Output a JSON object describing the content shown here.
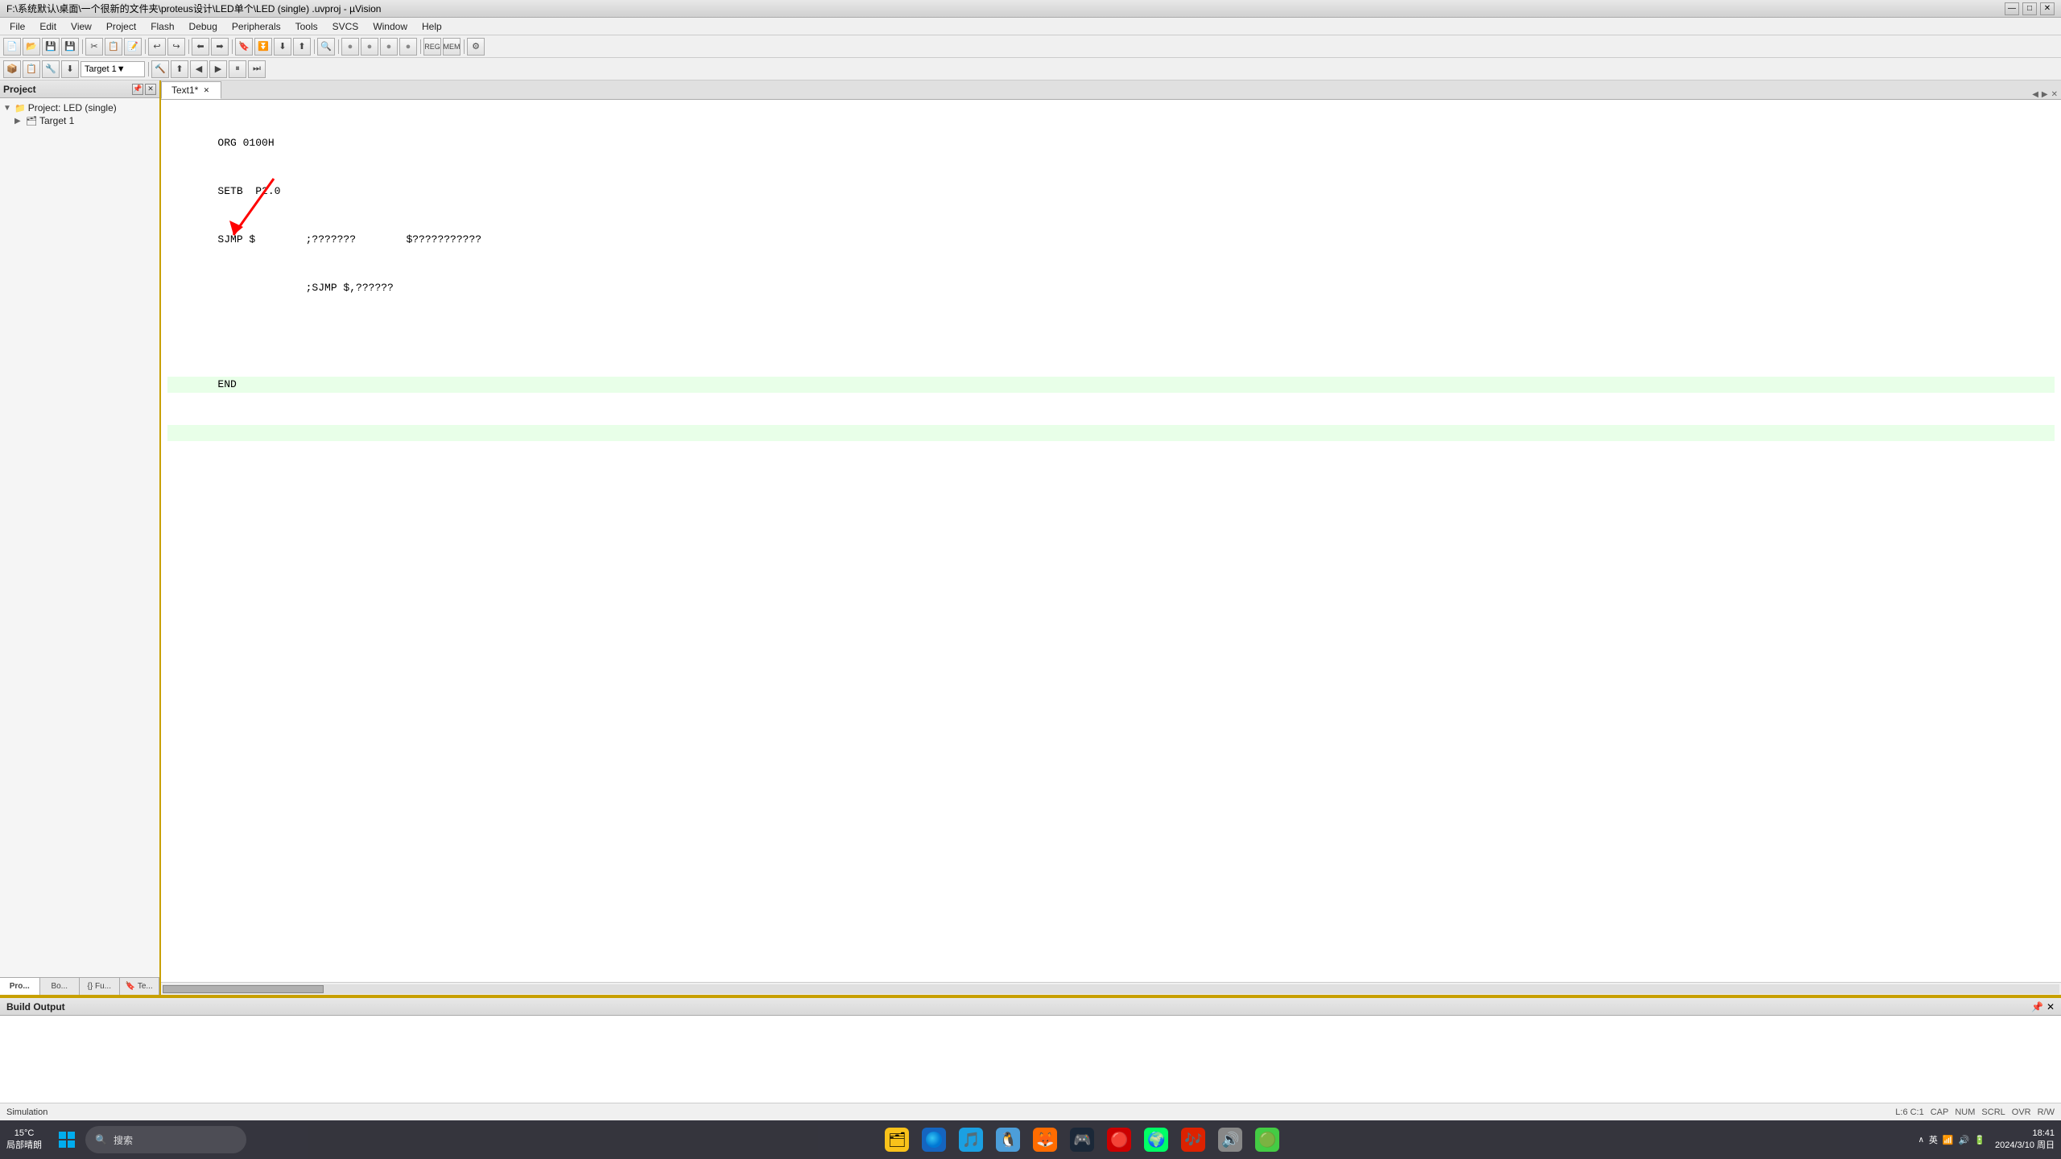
{
  "titleBar": {
    "title": "F:\\系统默认\\桌面\\一个很新的文件夹\\proteus设计\\LED单个\\LED (single) .uvproj - µVision",
    "controls": [
      "—",
      "□",
      "✕"
    ]
  },
  "menuBar": {
    "items": [
      "File",
      "Edit",
      "View",
      "Project",
      "Flash",
      "Debug",
      "Peripherals",
      "Tools",
      "SVCS",
      "Window",
      "Help"
    ]
  },
  "toolbar1": {
    "buttons": [
      "📄",
      "📂",
      "💾",
      "✂",
      "📋",
      "📝",
      "↩",
      "↪",
      "⬅",
      "➡",
      "⏹",
      "▶",
      "🔍"
    ]
  },
  "toolbar2": {
    "targetDropdown": "Target 1",
    "buttons": [
      "📦",
      "📋",
      "🔧",
      "◀",
      "▶",
      "⏸"
    ]
  },
  "projectPanel": {
    "title": "Project",
    "treeItems": [
      {
        "label": "Project: LED (single)",
        "level": 0,
        "icon": "📁",
        "expanded": true
      },
      {
        "label": "Target 1",
        "level": 1,
        "icon": "🗂",
        "expanded": false
      }
    ],
    "tabs": [
      {
        "label": "Pro...",
        "active": true
      },
      {
        "label": "Bo...",
        "active": false
      },
      {
        "label": "{} Fu...",
        "active": false
      },
      {
        "label": "🔖 Te...",
        "active": false
      }
    ]
  },
  "editor": {
    "tabs": [
      {
        "label": "Text1*",
        "active": true
      }
    ],
    "code": [
      {
        "line": "        ORG 0100H",
        "highlighted": false
      },
      {
        "line": "        SETB  P2.0",
        "highlighted": false
      },
      {
        "line": "        SJMP $        ;???????        $???????????",
        "highlighted": false
      },
      {
        "line": "                      ;SJMP $,??????",
        "highlighted": false
      },
      {
        "line": "",
        "highlighted": false
      },
      {
        "line": "        END",
        "highlighted": true
      },
      {
        "line": "",
        "highlighted": true
      }
    ]
  },
  "buildOutput": {
    "title": "Build Output",
    "content": ""
  },
  "statusBar": {
    "left": "Simulation",
    "position": "L:6 C:1",
    "caps": "CAP",
    "num": "NUM",
    "scrl": "SCRL",
    "ovr": "OVR",
    "rw": "R/W"
  },
  "taskbar": {
    "weather": {
      "temp": "15°C",
      "location": "局部晴朗"
    },
    "searchPlaceholder": "搜索",
    "apps": [
      {
        "name": "windows-start",
        "emoji": "⊞",
        "color": "#0078d4"
      },
      {
        "name": "file-explorer",
        "emoji": "🗂",
        "color": "#f9c21a"
      },
      {
        "name": "edge",
        "emoji": "🌐",
        "color": "#0078d4"
      },
      {
        "name": "kugou",
        "emoji": "🎵",
        "color": "#1ba0e2"
      },
      {
        "name": "penguin",
        "emoji": "🐧",
        "color": "#1b96e2"
      },
      {
        "name": "game1",
        "emoji": "🦊",
        "color": "#ff6c00"
      },
      {
        "name": "steam",
        "emoji": "🎮",
        "color": "#1b2838"
      },
      {
        "name": "app1",
        "emoji": "🔴",
        "color": "#c00"
      },
      {
        "name": "browser",
        "emoji": "🌍",
        "color": "#0f9"
      },
      {
        "name": "music",
        "emoji": "🎶",
        "color": "#d20"
      },
      {
        "name": "app2",
        "emoji": "🔊",
        "color": "#888"
      },
      {
        "name": "app3",
        "emoji": "🟢",
        "color": "#4c4"
      }
    ],
    "clock": {
      "time": "18:41",
      "date": "2024/3/10 周日"
    },
    "systray": {
      "lang": "英",
      "wifi": "WiFi",
      "sound": "🔊"
    }
  }
}
